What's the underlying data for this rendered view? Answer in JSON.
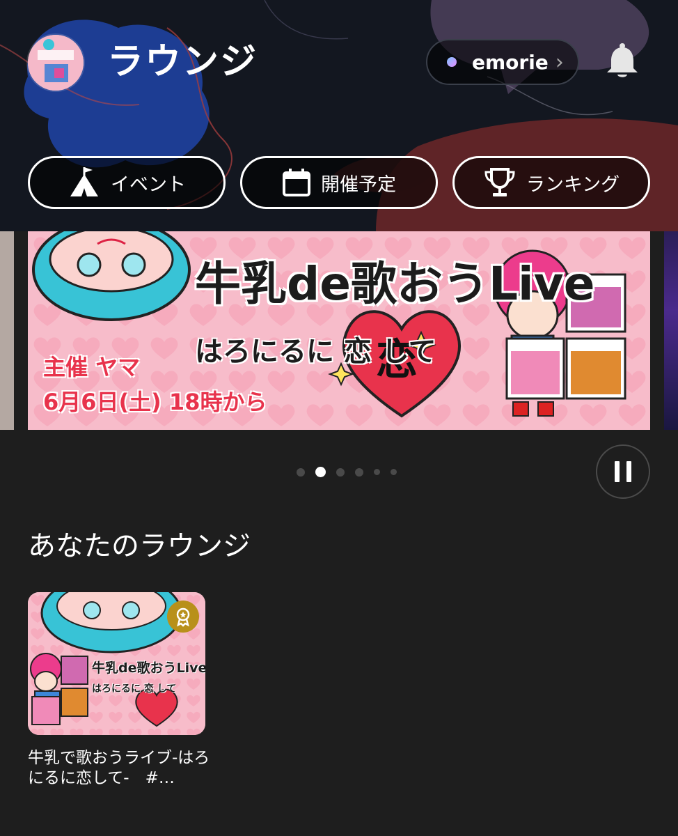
{
  "header": {
    "title": "ラウンジ",
    "emorie_label": "emorie",
    "emorie_chevron": "›",
    "icons": {
      "avatar": "lounge-avatar",
      "bell": "bell-icon"
    }
  },
  "shortcuts": [
    {
      "label": "イベント",
      "icon": "tent-icon"
    },
    {
      "label": "開催予定",
      "icon": "calendar-icon"
    },
    {
      "label": "ランキング",
      "icon": "trophy-icon"
    }
  ],
  "carousel": {
    "banner": {
      "title": "牛乳de歌おうLive",
      "subtitle": "はろにるに 恋 して",
      "host": "主催 ヤマ",
      "date": "6月6日(土) 18時から"
    },
    "page_count": 6,
    "active_index": 1
  },
  "your_lounge": {
    "section_title": "あなたのラウンジ",
    "card": {
      "thumb_title": "牛乳de歌おうLive",
      "thumb_subtitle": "はろにるに 恋 して",
      "caption": "牛乳で歌おうライブ-はろにるに恋して-　#…",
      "badge_icon": "award-medal-icon"
    }
  },
  "colors": {
    "background": "#1e1e1e",
    "banner_pink": "#f7bcca",
    "accent_red": "#e8334c",
    "medal_gold": "#b8901a"
  }
}
